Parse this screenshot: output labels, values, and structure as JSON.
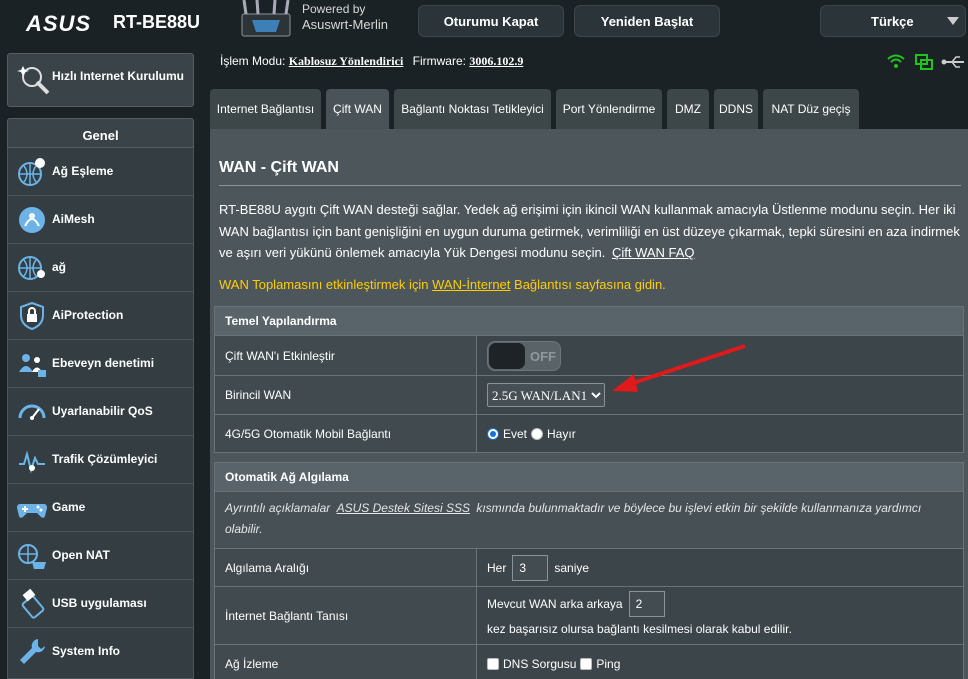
{
  "header": {
    "brand": "ASUS",
    "model": "RT-BE88U",
    "powered_line1": "Powered by",
    "powered_line2": "Asuswrt-Merlin",
    "logout_label": "Oturumu Kapat",
    "reboot_label": "Yeniden Başlat",
    "language": "Türkçe"
  },
  "sidebar": {
    "quick_setup": "Hızlı Internet Kurulumu",
    "section_title": "Genel",
    "items": [
      {
        "label": "Ağ Eşleme",
        "icon": "network-map-icon"
      },
      {
        "label": "AiMesh",
        "icon": "aimesh-icon"
      },
      {
        "label": "ağ",
        "icon": "globe-icon"
      },
      {
        "label": "AiProtection",
        "icon": "shield-lock-icon"
      },
      {
        "label": "Ebeveyn denetimi",
        "icon": "parental-control-icon"
      },
      {
        "label": "Uyarlanabilir QoS",
        "icon": "speedometer-icon"
      },
      {
        "label": "Trafik Çözümleyici",
        "icon": "traffic-analyzer-icon"
      },
      {
        "label": "Game",
        "icon": "gamepad-icon"
      },
      {
        "label": "Open NAT",
        "icon": "open-nat-icon"
      },
      {
        "label": "USB uygulaması",
        "icon": "usb-icon"
      },
      {
        "label": "System Info",
        "icon": "wrench-icon"
      }
    ]
  },
  "status": {
    "mode_label": "İşlem Modu:",
    "mode_value": "Kablosuz Yönlendirici",
    "fw_label": "Firmware:",
    "fw_value": "3006.102.9"
  },
  "tabs": [
    {
      "label": "Internet Bağlantısı",
      "active": false
    },
    {
      "label": "Çift WAN",
      "active": true
    },
    {
      "label": "Bağlantı Noktası Tetikleyici",
      "active": false
    },
    {
      "label": "Port Yönlendirme",
      "active": false
    },
    {
      "label": "DMZ",
      "active": false
    },
    {
      "label": "DDNS",
      "active": false
    },
    {
      "label": "NAT Düz geçiş",
      "active": false
    }
  ],
  "main": {
    "title": "WAN - Çift WAN",
    "description": "RT-BE88U aygıtı Çift WAN desteği sağlar. Yedek ağ erişimi için ikincil WAN kullanmak amacıyla Üstlenme modunu seçin. Her iki WAN bağlantısı için bant genişliğini en uygun duruma getirmek, verimliliği en üst düzeye çıkarmak, tepki süresini en aza indirmek ve aşırı veri yükünü önlemek amacıyla Yük Dengesi modunu seçin.",
    "faq_link": "Çift WAN FAQ",
    "note_prefix": "WAN Toplamasını etkinleştirmek için",
    "note_link": "WAN-İnternet",
    "note_suffix": "Bağlantısı sayfasına gidin."
  },
  "basic": {
    "header": "Temel Yapılandırma",
    "enable_label": "Çift WAN'ı Etkinleştir",
    "toggle_state": "OFF",
    "primary_label": "Birincil WAN",
    "primary_value": "2.5G WAN/LAN1",
    "mobile_label": "4G/5G Otomatik Mobil Bağlantı",
    "yes_label": "Evet",
    "no_label": "Hayır",
    "mobile_selected": "Evet"
  },
  "detect": {
    "header": "Otomatik Ağ Algılama",
    "expl_prefix": "Ayrıntılı açıklamalar",
    "expl_link": "ASUS Destek Sitesi SSS",
    "expl_suffix": "kısmında bulunmaktadır ve böylece bu işlevi etkin bir şekilde kullanmanıza yardımcı olabilir.",
    "interval_label": "Algılama Aralığı",
    "interval_prefix": "Her",
    "interval_value": "3",
    "interval_unit": "saniye",
    "diag_label": "İnternet Bağlantı Tanısı",
    "diag_prefix": "Mevcut WAN arka arkaya",
    "diag_value": "2",
    "diag_suffix": "kez başarısız olursa bağlantı kesilmesi olarak kabul edilir.",
    "monitor_label": "Ağ İzleme",
    "dns_label": "DNS Sorgusu",
    "ping_label": "Ping"
  },
  "colors": {
    "accent_note": "#ffcc00",
    "arrow": "#e0191a",
    "wifi_icon": "#22c31a"
  }
}
